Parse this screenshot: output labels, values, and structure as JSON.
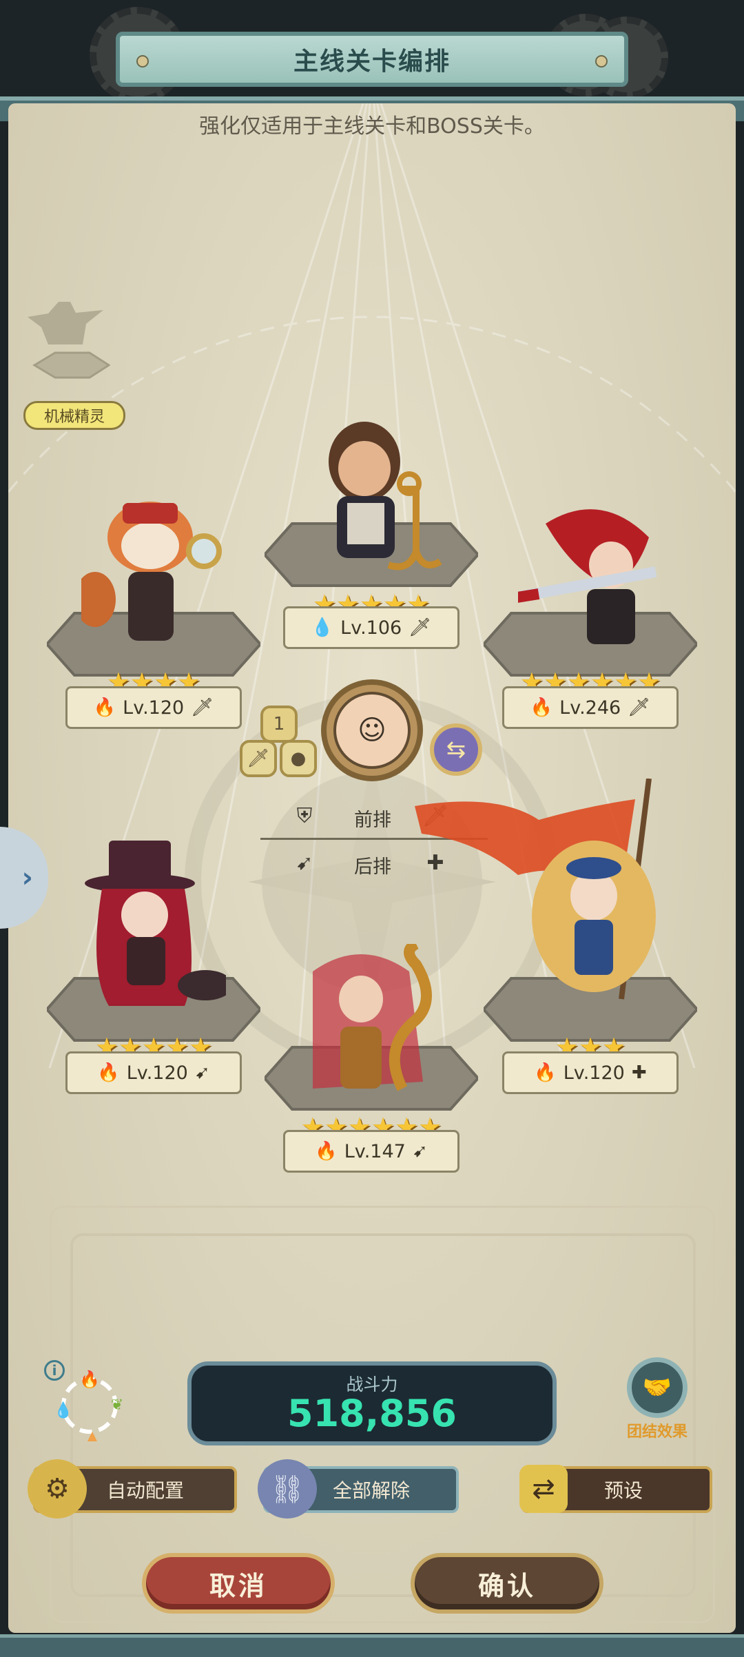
{
  "title": "主线关卡编排",
  "subtitle": "强化仅适用于主线关卡和BOSS关卡。",
  "sprite_tag": "机械精灵",
  "heroes": [
    {
      "stars": "★★★★★",
      "level": "Lv.106",
      "element_icon": "water-drop-icon",
      "role_icon": "sword-icon",
      "element_glyph": "💧",
      "role_glyph": "🗡"
    },
    {
      "stars": "★★★★",
      "level": "Lv.120",
      "element_icon": "fire-icon",
      "role_icon": "sword-icon",
      "element_glyph": "🔥",
      "role_glyph": "🗡"
    },
    {
      "stars": "★★★★★★",
      "level": "Lv.246",
      "element_icon": "fire-icon",
      "role_icon": "sword-icon",
      "element_glyph": "🔥",
      "role_glyph": "🗡"
    },
    {
      "stars": "★★★★★",
      "level": "Lv.120",
      "element_icon": "fire-icon",
      "role_icon": "bow-icon",
      "element_glyph": "🔥",
      "role_glyph": "➹"
    },
    {
      "stars": "★★★",
      "level": "Lv.120",
      "element_icon": "fire-icon",
      "role_icon": "heal-icon",
      "element_glyph": "🔥",
      "role_glyph": "✚"
    },
    {
      "stars": "★★★★★★",
      "level": "Lv.147",
      "element_icon": "fire-icon",
      "role_icon": "bow-icon",
      "element_glyph": "🔥",
      "role_glyph": "➹"
    }
  ],
  "leader_slot_number": "1",
  "front_row_label": "前排",
  "back_row_label": "后排",
  "power_label": "战斗力",
  "power_value": "518,856",
  "bond_label": "团结效果",
  "buttons": {
    "auto": "自动配置",
    "clear": "全部解除",
    "preset": "预设",
    "cancel": "取消",
    "confirm": "确认"
  },
  "colors": {
    "power_value": "#37e3b0",
    "star": "#f7c637",
    "cancel_bg": "#a8453a",
    "confirm_bg": "#5e4634"
  }
}
